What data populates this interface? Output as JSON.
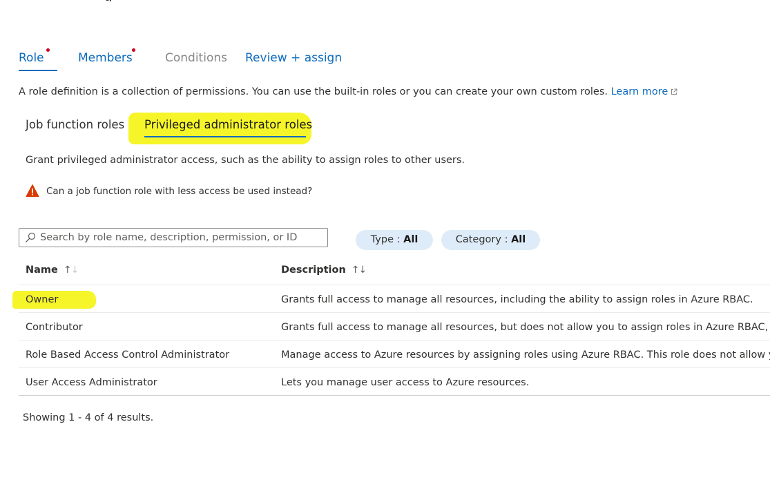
{
  "page_heading_fragment": "g",
  "tabs": [
    {
      "label": "Role",
      "state": "active",
      "required": true
    },
    {
      "label": "Members",
      "state": "link",
      "required": true
    },
    {
      "label": "Conditions",
      "state": "disabled",
      "required": false
    },
    {
      "label": "Review + assign",
      "state": "link",
      "required": false
    }
  ],
  "intro": {
    "text": "A role definition is a collection of permissions. You can use the built-in roles or you can create your own custom roles.",
    "learn_more": "Learn more"
  },
  "subtabs": [
    {
      "label": "Job function roles",
      "selected": false
    },
    {
      "label": "Privileged administrator roles",
      "selected": true
    }
  ],
  "grant_text": "Grant privileged administrator access, such as the ability to assign roles to other users.",
  "warning_text": "Can a job function role with less access be used instead?",
  "search": {
    "placeholder": "Search by role name, description, permission, or ID",
    "value": ""
  },
  "filters": [
    {
      "label": "Type : ",
      "value": "All"
    },
    {
      "label": "Category : ",
      "value": "All"
    }
  ],
  "table": {
    "columns": [
      "Name",
      "Description"
    ],
    "rows": [
      {
        "name": "Owner",
        "description": "Grants full access to manage all resources, including the ability to assign roles in Azure RBAC."
      },
      {
        "name": "Contributor",
        "description": "Grants full access to manage all resources, but does not allow you to assign roles in Azure RBAC, m"
      },
      {
        "name": "Role Based Access Control Administrator",
        "description": "Manage access to Azure resources by assigning roles using Azure RBAC. This role does not allow yo"
      },
      {
        "name": "User Access Administrator",
        "description": "Lets you manage user access to Azure resources."
      }
    ]
  },
  "footer": "Showing 1 - 4 of 4 results.",
  "colors": {
    "accent": "#0f6cbd",
    "required_dot": "#d0021b",
    "highlighter": "#f5f52a",
    "warning": "#d83b01",
    "pill_bg": "#deecf9"
  },
  "icons": {
    "external": "external-link-icon",
    "warning": "warning-icon",
    "search": "search-icon",
    "sort": "sort-arrows-icon"
  }
}
